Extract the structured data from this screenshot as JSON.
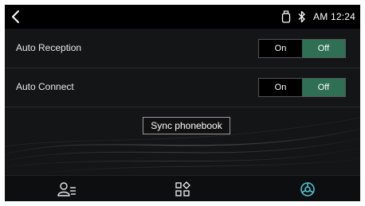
{
  "status_bar": {
    "time": "AM 12:24",
    "icons": [
      "back-arrow-icon",
      "usb-storage-icon",
      "bluetooth-icon"
    ]
  },
  "settings": {
    "auto_reception": {
      "label": "Auto Reception",
      "on_label": "On",
      "off_label": "Off",
      "selected": "Off"
    },
    "auto_connect": {
      "label": "Auto Connect",
      "on_label": "On",
      "off_label": "Off",
      "selected": "Off"
    },
    "sync_button_label": "Sync phonebook"
  },
  "bottom_nav": {
    "items": [
      "contacts-icon",
      "apps-icon",
      "settings-icon"
    ],
    "active": "settings-icon"
  },
  "colors": {
    "background": "#141516",
    "status_bar": "#000000",
    "selected_toggle": "#2f6f54",
    "active_accent": "#3fb8c9"
  }
}
